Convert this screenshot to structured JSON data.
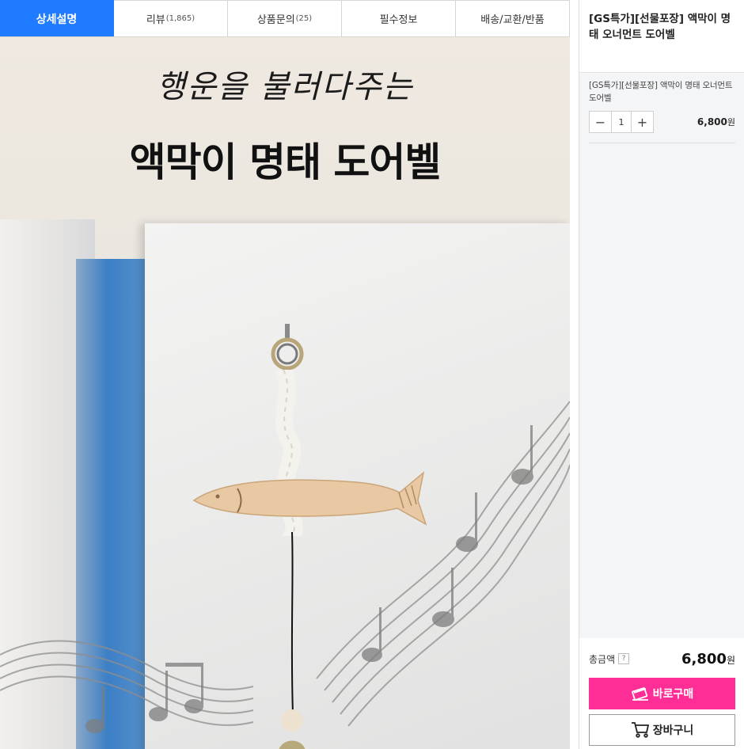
{
  "tabs": [
    {
      "label": "상세설명",
      "count": ""
    },
    {
      "label": "리뷰",
      "count": "(1,865)"
    },
    {
      "label": "상품문의",
      "count": "(25)"
    },
    {
      "label": "필수정보",
      "count": ""
    },
    {
      "label": "배송/교환/반품",
      "count": ""
    }
  ],
  "banner": {
    "script_text": "행운을 불러다주는",
    "main_text": "액막이 명태 도어벨"
  },
  "sidebar": {
    "product_title": "[GS특가][선물포장] 액막이 명태 오너먼트 도어벨",
    "option": {
      "name": "[GS특가][선물포장] 액막이 명태 오너먼트 도어벨",
      "minus": "−",
      "quantity": "1",
      "plus": "+",
      "price": "6,800",
      "won": "원"
    },
    "total": {
      "label": "총금액",
      "help": "?",
      "price": "6,800",
      "won": "원"
    },
    "buy_label": "바로구매",
    "cart_label": "장바구니"
  },
  "colors": {
    "tab_active": "#1f7bff",
    "buy_button": "#ff2d96"
  },
  "icons": {
    "buy": "card-icon",
    "cart": "cart-icon",
    "help": "help-icon"
  }
}
